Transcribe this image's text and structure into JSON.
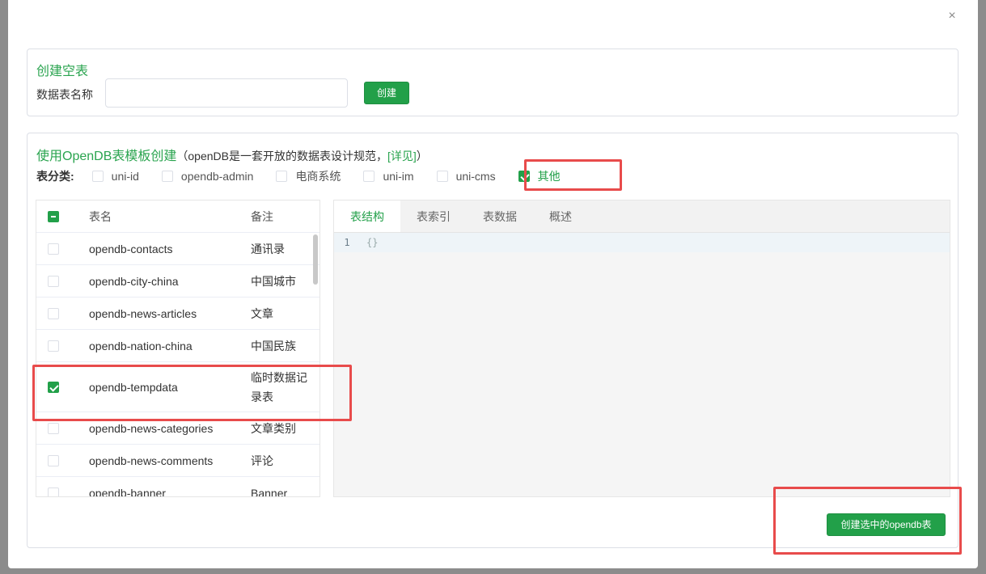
{
  "dialog": {
    "close_glyph": "×",
    "empty_table": {
      "title": "创建空表",
      "name_label": "数据表名称",
      "name_value": "",
      "create_button": "创建"
    },
    "opendb": {
      "title_main": "使用OpenDB表模板创建",
      "title_desc": "（openDB是一套开放的数据表设计规范，",
      "title_link": "[详见]",
      "title_end": "）",
      "category_label": "表分类:",
      "categories": [
        {
          "label": "uni-id",
          "checked": false
        },
        {
          "label": "opendb-admin",
          "checked": false
        },
        {
          "label": "电商系统",
          "checked": false
        },
        {
          "label": "uni-im",
          "checked": false
        },
        {
          "label": "uni-cms",
          "checked": false
        },
        {
          "label": "其他",
          "checked": true
        }
      ],
      "table": {
        "col_name": "表名",
        "col_note": "备注",
        "rows": [
          {
            "name": "opendb-contacts",
            "note": "通讯录",
            "checked": false
          },
          {
            "name": "opendb-city-china",
            "note": "中国城市",
            "checked": false
          },
          {
            "name": "opendb-news-articles",
            "note": "文章",
            "checked": false
          },
          {
            "name": "opendb-nation-china",
            "note": "中国民族",
            "checked": false
          },
          {
            "name": "opendb-tempdata",
            "note": "临时数据记录表",
            "checked": true
          },
          {
            "name": "opendb-news-categories",
            "note": "文章类别",
            "checked": false
          },
          {
            "name": "opendb-news-comments",
            "note": "评论",
            "checked": false
          },
          {
            "name": "opendb-banner",
            "note": "Banner",
            "checked": false
          }
        ]
      },
      "tabs": [
        {
          "label": "表结构",
          "active": true
        },
        {
          "label": "表索引",
          "active": false
        },
        {
          "label": "表数据",
          "active": false
        },
        {
          "label": "概述",
          "active": false
        }
      ],
      "editor": {
        "line_number": "1",
        "code": "{}"
      },
      "submit_button": "创建选中的opendb表"
    }
  },
  "colors": {
    "accent": "#22a049",
    "highlight": "#e84b4b"
  }
}
